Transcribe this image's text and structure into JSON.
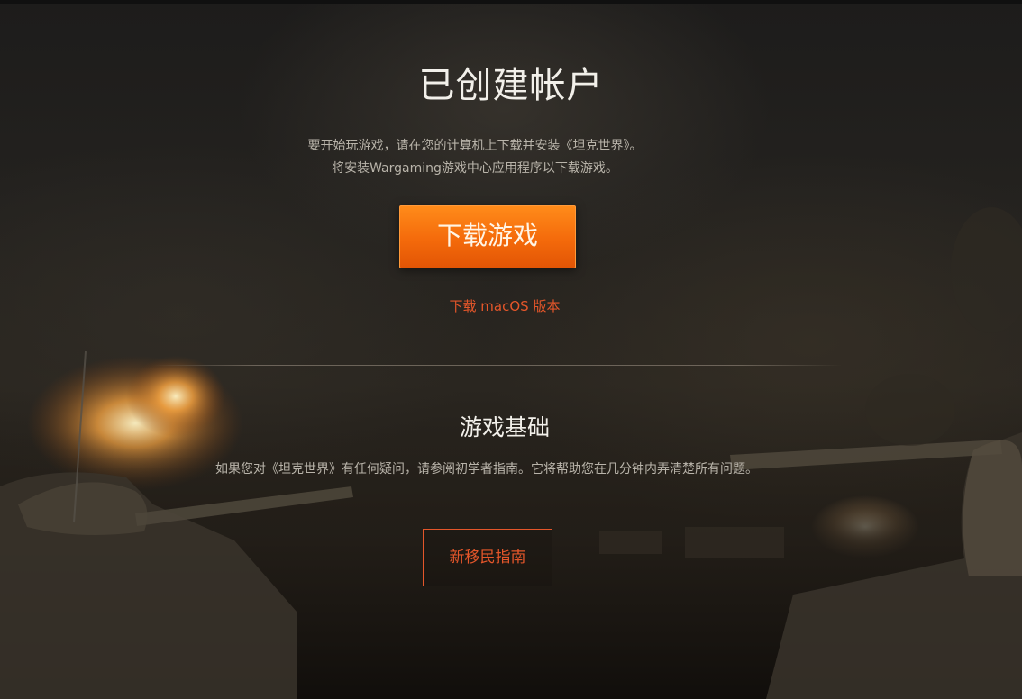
{
  "header": {
    "title": "已创建帐户"
  },
  "intro": {
    "line1": "要开始玩游戏，请在您的计算机上下载并安装《坦克世界》。",
    "line2": "将安装Wargaming游戏中心应用程序以下载游戏。"
  },
  "actions": {
    "download_label": "下载游戏",
    "mac_link_label": "下载 macOS 版本"
  },
  "basics": {
    "title": "游戏基础",
    "text": "如果您对《坦克世界》有任何疑问，请参阅初学者指南。它将帮助您在几分钟内弄清楚所有问题。",
    "guide_label": "新移民指南"
  },
  "colors": {
    "accent_orange": "#f46a0b",
    "link_red": "#e4562a",
    "background": "#1f1c18",
    "text_light": "#f2f0ea",
    "text_muted": "#b9b4aa"
  }
}
